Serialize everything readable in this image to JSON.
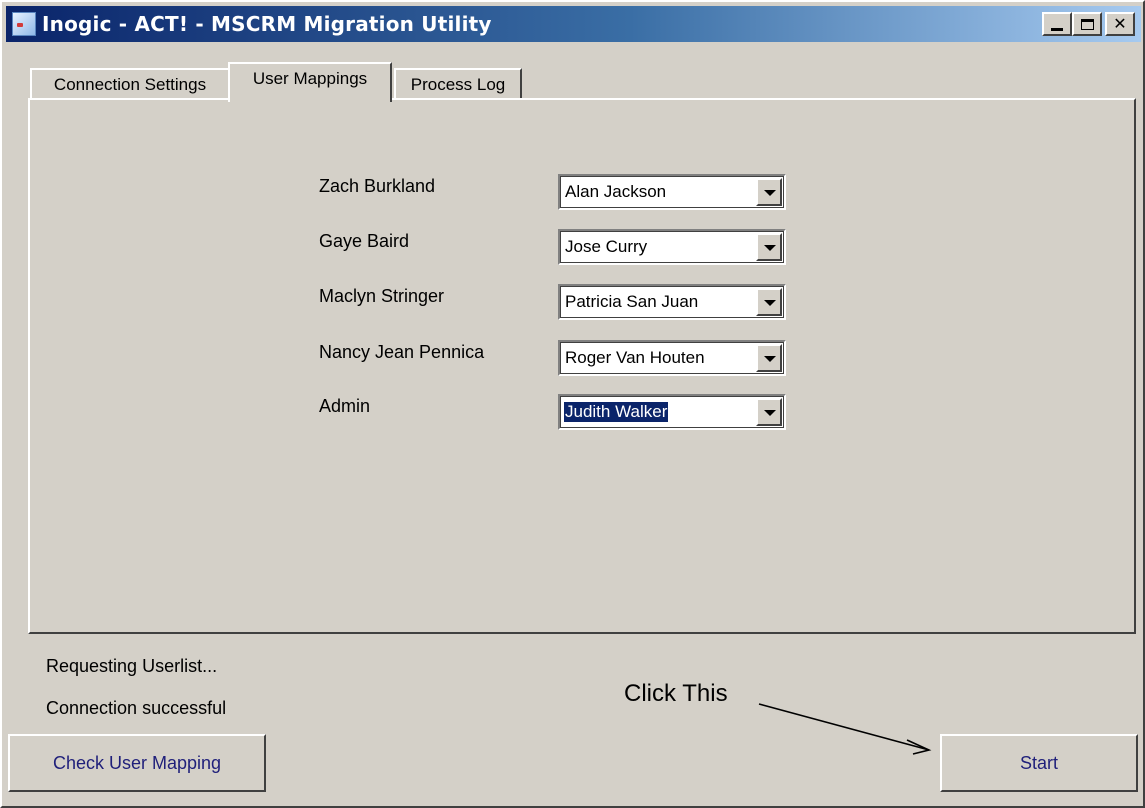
{
  "window": {
    "title": "Inogic - ACT! - MSCRM Migration Utility"
  },
  "tabs": [
    {
      "label": "Connection Settings",
      "active": false
    },
    {
      "label": "User Mappings",
      "active": true
    },
    {
      "label": "Process Log",
      "active": false
    }
  ],
  "mappings": [
    {
      "act_user": "Zach Burkland",
      "crm_user": "Alan Jackson"
    },
    {
      "act_user": "Gaye Baird",
      "crm_user": "Jose Curry"
    },
    {
      "act_user": "Maclyn Stringer",
      "crm_user": "Patricia San Juan"
    },
    {
      "act_user": "Nancy Jean Pennica",
      "crm_user": "Roger Van Houten"
    },
    {
      "act_user": "Admin",
      "crm_user": "Judith Walker"
    }
  ],
  "status": {
    "line1": "Requesting Userlist...",
    "line2": "Connection successful"
  },
  "buttons": {
    "check_mapping": "Check User Mapping",
    "start": "Start"
  },
  "annotation": {
    "text": "Click This"
  },
  "colors": {
    "titlebar_start": "#0a246a",
    "titlebar_end": "#a6caf0",
    "face": "#d4d0c8",
    "selection": "#0a246a",
    "button_text": "#1f1f7a"
  },
  "icons": [
    "app-icon",
    "minimize-icon",
    "maximize-icon",
    "close-icon",
    "dropdown-arrow-icon"
  ]
}
